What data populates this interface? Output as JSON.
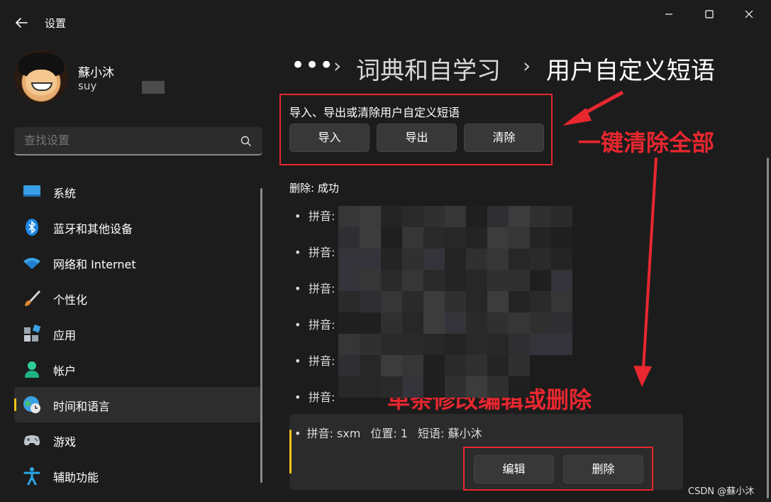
{
  "window": {
    "title": "设置"
  },
  "user": {
    "name": "蘇小沐",
    "email": "suy"
  },
  "search": {
    "placeholder": "查找设置"
  },
  "nav": {
    "items": [
      {
        "label": "系统",
        "icon": "monitor-icon"
      },
      {
        "label": "蓝牙和其他设备",
        "icon": "bluetooth-icon"
      },
      {
        "label": "网络和 Internet",
        "icon": "wifi-icon"
      },
      {
        "label": "个性化",
        "icon": "paintbrush-icon"
      },
      {
        "label": "应用",
        "icon": "apps-icon"
      },
      {
        "label": "帐户",
        "icon": "person-icon"
      },
      {
        "label": "时间和语言",
        "icon": "globe-clock-icon",
        "active": true
      },
      {
        "label": "游戏",
        "icon": "gamepad-icon"
      },
      {
        "label": "辅助功能",
        "icon": "accessibility-icon"
      }
    ]
  },
  "breadcrumb": {
    "overflow": "•••",
    "separator": "›",
    "items": [
      "词典和自学习",
      "用户自定义短语"
    ]
  },
  "io_section": {
    "title": "导入、导出或清除用户自定义短语",
    "import_label": "导入",
    "export_label": "导出",
    "clear_label": "清除"
  },
  "status_text": "删除: 成功",
  "entries": {
    "bullet": "•",
    "prefix": "拼音:",
    "count_blurred": 6
  },
  "selected_entry": {
    "pinyin": "拼音: sxm",
    "position": "位置: 1",
    "phrase": "短语: 蘇小沐",
    "edit_label": "编辑",
    "delete_label": "删除"
  },
  "annotations": {
    "clear_all": "一键清除全部",
    "single_edit": "单条修改编辑或删除"
  },
  "watermark": "CSDN @蘇小沐",
  "colors": {
    "background": "#1c1c1c",
    "accent": "#f5c518",
    "annotation": "#e8272f"
  }
}
